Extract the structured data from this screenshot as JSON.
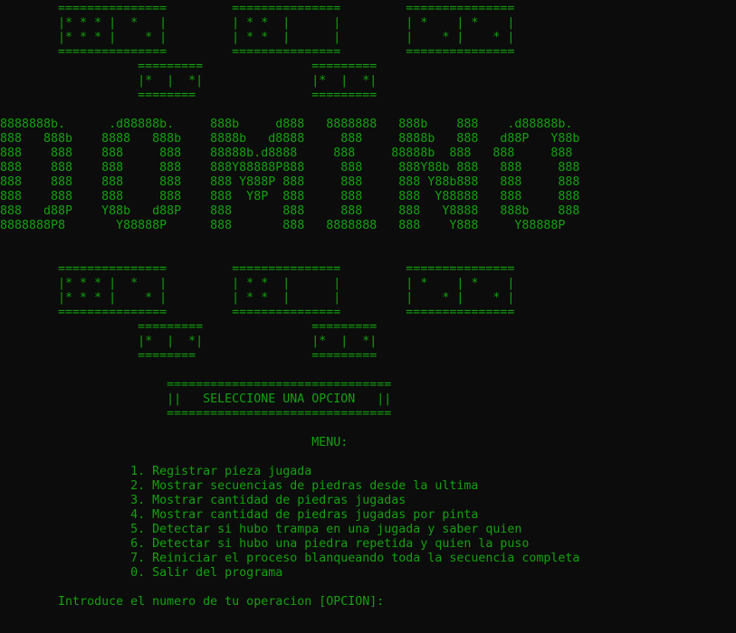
{
  "colors": {
    "background": "#0c0c0c",
    "text": "#13a10e"
  },
  "terminal": {
    "top_art": [
      "        ===============         ===============         ===============",
      "        |* * * |  *   |         | * *  |      |         | *    | *    |",
      "        |* * * |    * |         | * *  |      |         |    * |    * |",
      "        ===============         ===============         ===============",
      "                   =========               =========",
      "                   |*  |  *|               |*  |  *|",
      "                   ========                =========",
      "",
      "8888888b.      .d88888b.     888b     d888   8888888   888b    888    .d88888b.",
      "888   888b    8888   888b    8888b   d8888     888     8888b   888   d88P   Y88b",
      "888    888    888     888    88888b.d8888     888     88888b  888   888     888",
      "888    888    888     888    888Y88888P888     888     888Y88b 888   888     888",
      "888    888    888     888    888 Y888P 888     888     888 Y88b888   888     888",
      "888    888    888     888    888  Y8P  888     888     888  Y88888   888     888",
      "888   d88P    Y88b   d88P    888       888     888     888   Y8888   888b    888",
      "8888888P8       Y88888P      888       888   8888888   888    Y888     Y88888P"
    ],
    "bottom_art": [
      "        ===============         ===============         ===============",
      "        |* * * |  *   |         | * *  |      |         | *    | *    |",
      "        |* * * |    * |         | * *  |      |         |    * |    * |",
      "        ===============         ===============         ===============",
      "                   =========               =========",
      "                   |*  |  *|               |*  |  *|",
      "                   ========                ========="
    ],
    "banner": [
      "                       ===============================",
      "                       ||   SELECCIONE UNA OPCION   ||",
      "                       ==============================="
    ],
    "menu_title": "                                           MENU:",
    "menu_items": [
      "                  1. Registrar pieza jugada",
      "                  2. Mostrar secuencias de piedras desde la ultima",
      "                  3. Mostrar cantidad de piedras jugadas",
      "                  4. Mostrar cantidad de piedras jugadas por pinta",
      "                  5. Detectar si hubo trampa en una jugada y saber quien",
      "                  6. Detectar si hubo una piedra repetida y quien la puso",
      "                  7. Reiniciar el proceso blanqueando toda la secuencia completa",
      "                  0. Salir del programa"
    ],
    "prompt": "        Introduce el numero de tu operacion [OPCION]:"
  }
}
